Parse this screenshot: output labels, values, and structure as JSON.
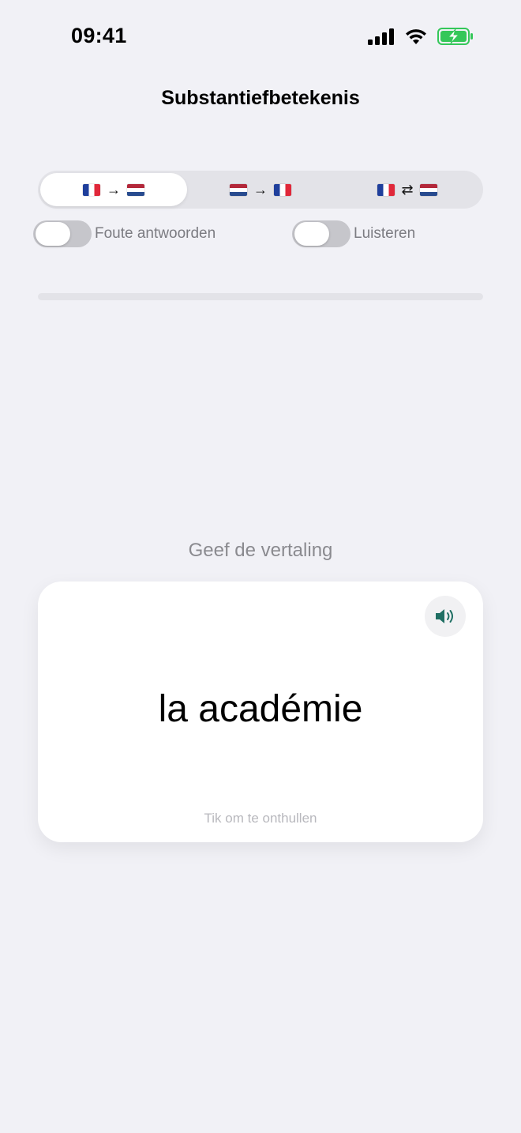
{
  "status_bar": {
    "time": "09:41",
    "battery_color": "#34c759"
  },
  "nav": {
    "title": "Substantiefbetekenis"
  },
  "direction_options": [
    {
      "from": "fr",
      "to": "nl",
      "arrow": "→",
      "selected": true
    },
    {
      "from": "nl",
      "to": "fr",
      "arrow": "→",
      "selected": false
    },
    {
      "from": "fr",
      "to": "nl",
      "arrow": "⇄",
      "selected": false
    }
  ],
  "toggles": {
    "wrong_answers": {
      "label": "Foute antwoorden",
      "on": false
    },
    "listen": {
      "label": "Luisteren",
      "on": false
    }
  },
  "progress": {
    "value": 0
  },
  "prompt": "Geef de vertaling",
  "card": {
    "word": "la académie",
    "hint": "Tik om te onthullen",
    "speaker_icon": "speaker-icon",
    "accent_color": "#1f6f63"
  }
}
